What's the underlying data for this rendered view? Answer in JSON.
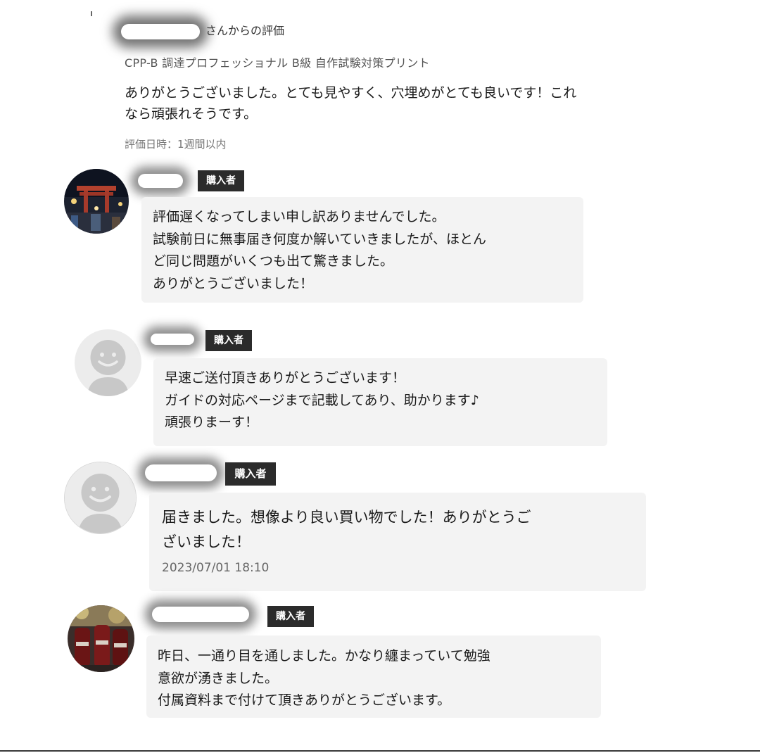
{
  "review": {
    "from_suffix": "さんからの評価",
    "product": "CPP-B 調達プロフェッショナル B級 自作試験対策プリント",
    "body": "ありがとうございました。とても見やすく、穴埋めがとても良いです！これなら頑張れそうです。",
    "date": "評価日時：1週間以内"
  },
  "comments": [
    {
      "badge": "購入者",
      "lines": [
        "評価遅くなってしまい申し訳ありませんでした。",
        "試験前日に無事届き何度か解いていきましたが、ほとん",
        "ど同じ問題がいくつも出て驚きました。",
        "ありがとうございました！"
      ],
      "avatar": "photo-shrine-icon"
    },
    {
      "badge": "購入者",
      "lines": [
        "早速ご送付頂きありがとうございます！",
        "ガイドの対応ページまで記載してあり、助かります♪",
        "頑張りまーす！"
      ],
      "avatar": "default-user-icon"
    },
    {
      "badge": "購入者",
      "lines": [
        "届きました。想像より良い買い物でした！ありがとうご",
        "ざいました！"
      ],
      "timestamp": "2023/07/01 18:10",
      "avatar": "default-user-icon"
    },
    {
      "badge": "購入者",
      "lines": [
        "昨日、一通り目を通しました。かなり纏まっていて勉強",
        "意欲が湧きました。",
        "付属資料まで付けて頂きありがとうございます。"
      ],
      "avatar": "photo-bottles-icon"
    }
  ],
  "colors": {
    "badge_bg": "#2b2b2b",
    "bubble_bg": "#f3f3f3",
    "default_avatar": "#c8c8c8"
  }
}
